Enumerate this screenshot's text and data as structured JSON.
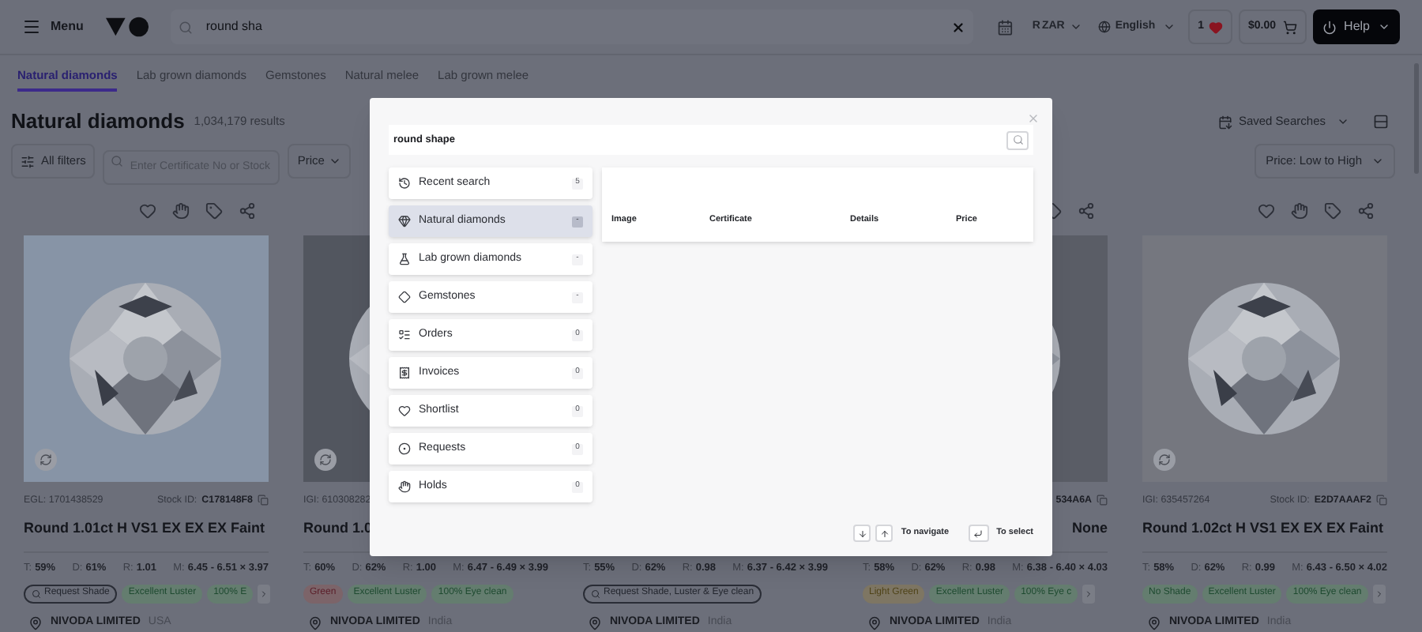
{
  "top_bar": {
    "menu": "Menu",
    "search": {
      "value": "round sha"
    },
    "currency_symbol": "R",
    "currency": "ZAR",
    "language": "English",
    "wishlist_count": "1",
    "cart_total": "$0.00",
    "help": "Help"
  },
  "tabs": [
    {
      "label": "Natural diamonds",
      "selected": true
    },
    {
      "label": "Lab grown diamonds",
      "selected": false
    },
    {
      "label": "Gemstones",
      "selected": false
    },
    {
      "label": "Natural melee",
      "selected": false
    },
    {
      "label": "Lab grown melee",
      "selected": false
    }
  ],
  "heading": {
    "title": "Natural diamonds",
    "count": "1,034,179 results",
    "saved_searches": "Saved Searches"
  },
  "filters": {
    "all_filters": "All filters",
    "search": {
      "placeholder": "Enter Certificate No or Stock"
    },
    "price": "Price",
    "sort": "Price: Low to High"
  },
  "cards": [
    {
      "actions": true,
      "picture": true,
      "cert": "EGL: 1701438529",
      "stock_label": "Stock ID:",
      "stock": "C178148F8",
      "title": "Round 1.01ct H VS1 EX EX EX Faint",
      "stats": [
        {
          "label": "T:",
          "value": "59%"
        },
        {
          "label": "D:",
          "value": "61%"
        },
        {
          "label": "R:",
          "value": "1.01"
        },
        {
          "label": "M:",
          "value": "6.45 - 6.51 × 3.97"
        }
      ],
      "tags": [
        {
          "kind": "request",
          "label": "Request Shade"
        },
        {
          "kind": "positive",
          "label": "Excellent Luster"
        },
        {
          "kind": "positive",
          "label": "100% E"
        }
      ],
      "more": true,
      "seller": "NIVODA LIMITED",
      "country": "USA"
    },
    {
      "picture": true,
      "cert": "IGI: 610308282",
      "title": "Round 1.0",
      "stats": [
        {
          "label": "T:",
          "value": "60%"
        },
        {
          "label": "D:",
          "value": "62%"
        },
        {
          "label": "R:",
          "value": "1.00"
        },
        {
          "label": "M:",
          "value": "6.47 - 6.49 × 3.99"
        }
      ],
      "tags": [
        {
          "kind": "negative",
          "label": "Green"
        },
        {
          "kind": "positive",
          "label": "Excellent Luster"
        },
        {
          "kind": "positive",
          "label": "100% Eye clean"
        }
      ],
      "more": false,
      "seller": "NIVODA LIMITED",
      "country": "India"
    },
    {
      "stats": [
        {
          "label": "T:",
          "value": "55%"
        },
        {
          "label": "D:",
          "value": "62%"
        },
        {
          "label": "R:",
          "value": "0.98"
        },
        {
          "label": "M:",
          "value": "6.37 - 6.42 × 3.99"
        }
      ],
      "tags": [
        {
          "kind": "request",
          "label": "Request Shade, Luster & Eye clean"
        }
      ],
      "more": false,
      "seller": "NIVODA LIMITED",
      "country": "India"
    },
    {
      "actions": true,
      "picture": true,
      "stock": "534A6A",
      "title": "None",
      "stats": [
        {
          "label": "T:",
          "value": "58%"
        },
        {
          "label": "D:",
          "value": "62%"
        },
        {
          "label": "R:",
          "value": "0.98"
        },
        {
          "label": "M:",
          "value": "6.38 - 6.40 × 4.03"
        }
      ],
      "tags": [
        {
          "kind": "warning",
          "label": "Light Green"
        },
        {
          "kind": "positive",
          "label": "Excellent Luster"
        },
        {
          "kind": "positive",
          "label": "100% Eye c"
        }
      ],
      "more": true,
      "seller": "NIVODA LIMITED",
      "country": "India"
    },
    {
      "actions": true,
      "picture": true,
      "cert": "IGI: 635457264",
      "stock_label": "Stock ID:",
      "stock": "E2D7AAAF2",
      "title": "Round 1.02ct H VS1 EX EX EX Faint",
      "stats": [
        {
          "label": "T:",
          "value": "58%"
        },
        {
          "label": "D:",
          "value": "62%"
        },
        {
          "label": "R:",
          "value": "0.99"
        },
        {
          "label": "M:",
          "value": "6.43 - 6.50 × 4.02"
        }
      ],
      "tags": [
        {
          "kind": "positive",
          "label": "No Shade"
        },
        {
          "kind": "positive",
          "label": "Excellent Luster"
        },
        {
          "kind": "positive",
          "label": "100% Eye clean"
        }
      ],
      "more": true,
      "seller": "NIVODA LIMITED",
      "country": "India"
    }
  ],
  "modal": {
    "search": {
      "value": "round shape"
    },
    "categories": [
      {
        "label": "Recent search",
        "count": "5",
        "selected": false
      },
      {
        "label": "Natural diamonds",
        "count": "-",
        "selected": true
      },
      {
        "label": "Lab grown diamonds",
        "count": "-",
        "selected": false
      },
      {
        "label": "Gemstones",
        "count": "-",
        "selected": false
      },
      {
        "label": "Orders",
        "count": "0",
        "selected": false
      },
      {
        "label": "Invoices",
        "count": "0",
        "selected": false
      },
      {
        "label": "Shortlist",
        "count": "0",
        "selected": false
      },
      {
        "label": "Requests",
        "count": "0",
        "selected": false
      },
      {
        "label": "Holds",
        "count": "0",
        "selected": false
      }
    ],
    "columns": [
      "Image",
      "Certificate",
      "Details",
      "Price"
    ],
    "hints": [
      {
        "kind": "navigate",
        "label": "To navigate"
      },
      {
        "kind": "select",
        "label": "To select"
      }
    ]
  }
}
